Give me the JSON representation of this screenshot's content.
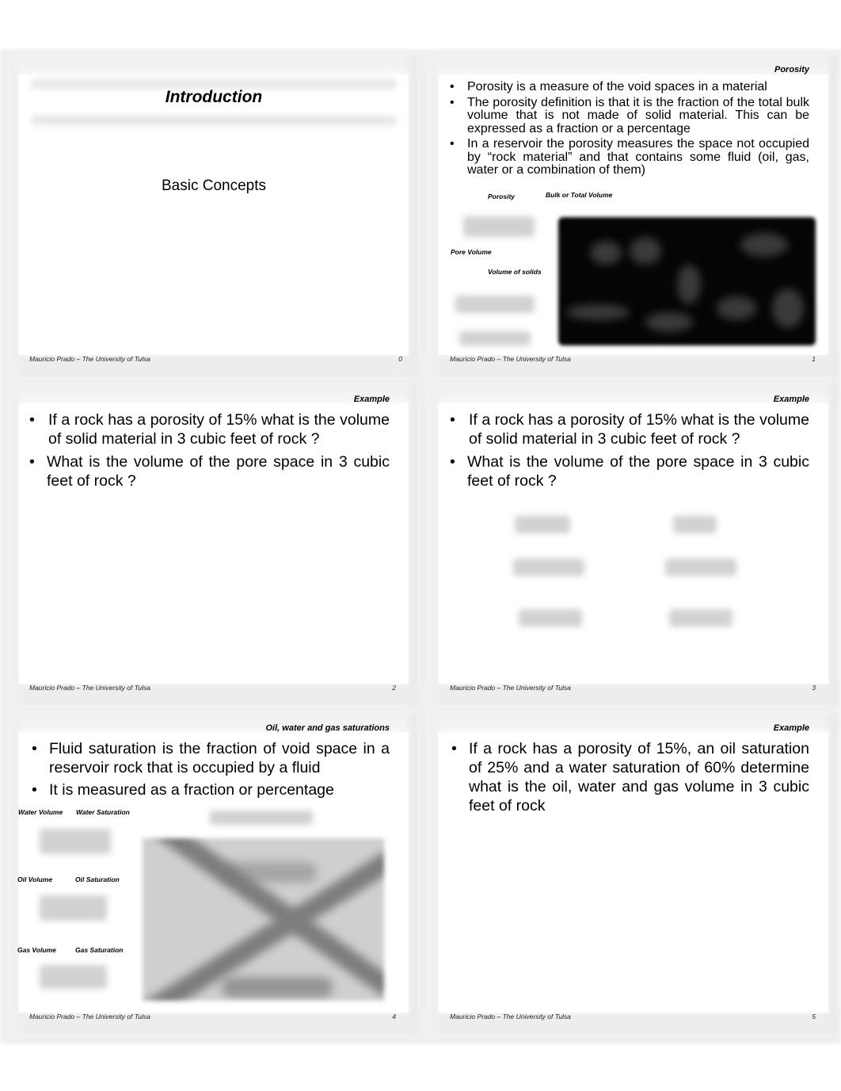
{
  "footer_author": "Mauricio Prado – The University of Tulsa",
  "slides": [
    {
      "number": "0",
      "title": "Introduction",
      "subtitle": "Basic Concepts"
    },
    {
      "number": "1",
      "heading": "Porosity",
      "bullets": [
        "Porosity is a measure of the void spaces in a material",
        "The porosity definition is that it is the fraction of the total bulk volume that is not made of solid material. This can be expressed as a fraction or a percentage",
        "In a reservoir the porosity measures the space not occupied by “rock material” and that contains some fluid (oil, gas, water or a combination of them)"
      ],
      "figure_labels": {
        "porosity": "Porosity",
        "bulk_volume": "Bulk or Total Volume",
        "pore_volume": "Pore Volume",
        "solids_volume": "Volume of solids"
      }
    },
    {
      "number": "2",
      "heading": "Example",
      "bullets": [
        "If a rock has a porosity of 15% what is the volume of solid material in 3 cubic feet of rock ?",
        "What is the volume of the pore space in 3 cubic feet of rock ?"
      ]
    },
    {
      "number": "3",
      "heading": "Example",
      "bullets": [
        "If a rock has a porosity of 15% what is the volume of solid material in 3 cubic feet of rock ?",
        "What is the volume of the pore space in 3 cubic feet of rock ?"
      ]
    },
    {
      "number": "4",
      "heading": "Oil, water and gas saturations",
      "bullets": [
        "Fluid saturation is the fraction of void space in a reservoir rock that is occupied by a fluid",
        "It is measured as a fraction or percentage"
      ],
      "figure_labels": {
        "water_volume": "Water Volume",
        "water_saturation": "Water Saturation",
        "oil_volume": "Oil Volume",
        "oil_saturation": "Oil Saturation",
        "gas_volume": "Gas Volume",
        "gas_saturation": "Gas Saturation"
      }
    },
    {
      "number": "5",
      "heading": "Example",
      "bullets": [
        "If a rock has a porosity of 15%, an oil saturation of 25% and a water saturation of 60% determine what is the oil, water and gas volume in 3 cubic feet of rock"
      ]
    }
  ],
  "bullet_glyph": "•"
}
